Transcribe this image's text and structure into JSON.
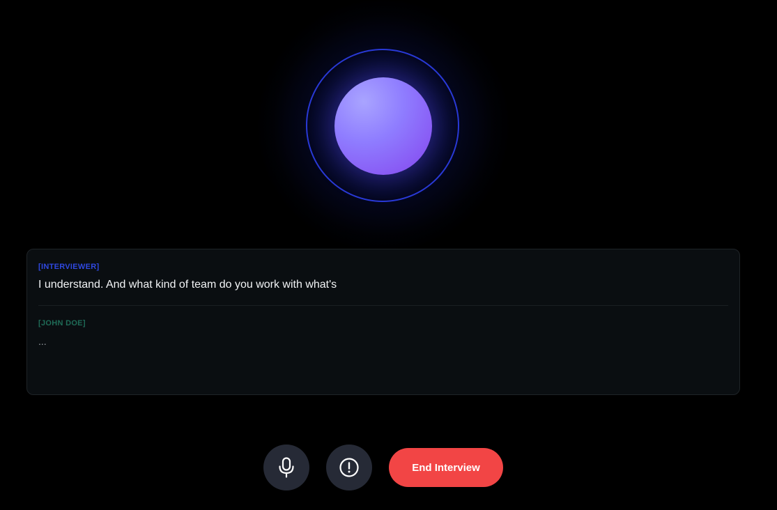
{
  "transcript": {
    "messages": [
      {
        "speaker": "[INTERVIEWER]",
        "text": "I understand. And what kind of team do you work with what's"
      },
      {
        "speaker": "[JOHN DOE]",
        "text": "..."
      }
    ]
  },
  "controls": {
    "mic_icon": "microphone-icon",
    "alert_icon": "exclamation-circle-icon",
    "end_label": "End Interview"
  },
  "colors": {
    "background": "#000000",
    "interviewer_label": "#2f48e0",
    "candidate_label": "#1f6b57",
    "end_button": "#f24545",
    "round_button": "#262a36",
    "orb_core": "#8f7dff",
    "orb_ring": "#2a3ad6"
  }
}
